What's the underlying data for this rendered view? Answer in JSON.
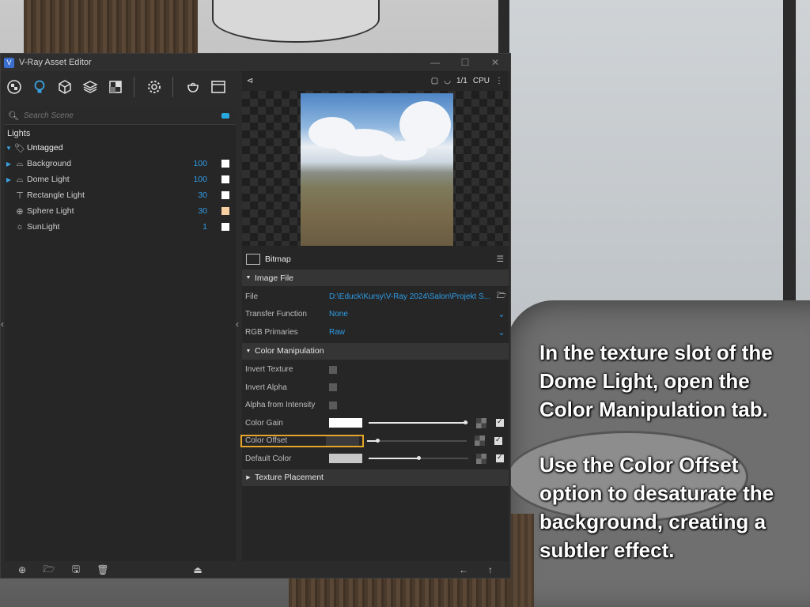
{
  "window": {
    "title": "V-Ray Asset Editor"
  },
  "toolbar": {
    "icons": [
      "materials-icon",
      "lights-icon",
      "geometry-icon",
      "layers-icon",
      "render-elements-icon",
      "settings-icon",
      "render-icon",
      "frame-buffer-icon"
    ]
  },
  "left": {
    "search_placeholder": "Search Scene",
    "category": "Lights",
    "group": "Untagged",
    "lights": [
      {
        "name": "Background",
        "value": "100",
        "swatch": "#ffffff",
        "icon": "dome"
      },
      {
        "name": "Dome Light",
        "value": "100",
        "swatch": "#ffffff",
        "icon": "dome"
      },
      {
        "name": "Rectangle Light",
        "value": "30",
        "swatch": "#ffffff",
        "icon": "rect"
      },
      {
        "name": "Sphere Light",
        "value": "30",
        "swatch": "#f7cfa2",
        "icon": "sphere"
      },
      {
        "name": "SunLight",
        "value": "1",
        "swatch": "#ffffff",
        "icon": "sun"
      }
    ]
  },
  "preview": {
    "ratio": "1/1",
    "engine": "CPU"
  },
  "material": {
    "name": "Bitmap"
  },
  "sections": {
    "image_file": "Image File",
    "color_manipulation": "Color Manipulation",
    "texture_placement": "Texture Placement"
  },
  "image_file": {
    "file_label": "File",
    "file_value": "D:\\Educk\\Kursy\\V-Ray 2024\\Salon\\Projekt S...",
    "transfer_label": "Transfer Function",
    "transfer_value": "None",
    "rgb_label": "RGB Primaries",
    "rgb_value": "Raw"
  },
  "color_manipulation": {
    "invert_texture": "Invert Texture",
    "invert_alpha": "Invert Alpha",
    "alpha_from_intensity": "Alpha from Intensity",
    "color_gain": {
      "label": "Color Gain",
      "color": "#ffffff",
      "level": 0.97
    },
    "color_offset": {
      "label": "Color Offset",
      "color": "#3a3a3a",
      "level": 0.1
    },
    "default_color": {
      "label": "Default Color",
      "color": "#c6c6c6",
      "level": 0.5
    }
  },
  "caption": {
    "paragraph1": "In the texture slot of the Dome Light, open the Color Manipulation tab.",
    "paragraph2": "Use the Color Offset option to desaturate the background, creating a subtler effect."
  }
}
